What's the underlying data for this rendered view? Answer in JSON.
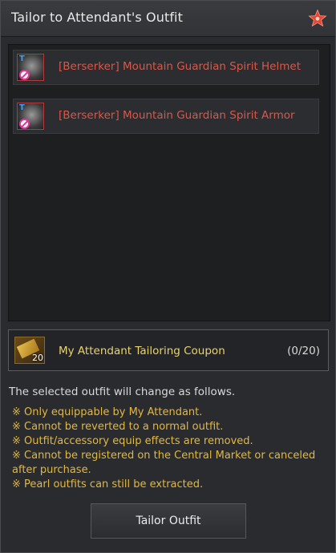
{
  "window": {
    "title": "Tailor to Attendant's Outfit",
    "star_icon": "star-icon",
    "accent_color": "#e0463a"
  },
  "outfits": [
    {
      "name": "[Berserker] Mountain Guardian Spirit Helmet",
      "icon": "helmet-icon",
      "badge": "T"
    },
    {
      "name": "[Berserker] Mountain Guardian Spirit Armor",
      "icon": "armor-icon",
      "badge": "T"
    }
  ],
  "coupon": {
    "name": "My Attendant Tailoring Coupon",
    "quantity": "(0/20)",
    "icon_count": "20",
    "icon": "coupon-icon"
  },
  "info": {
    "intro": "The selected outfit will change as follows.",
    "notes": [
      "※ Only equippable by My Attendant.",
      "※ Cannot be reverted to a normal outfit.",
      "※ Outfit/accessory equip effects are removed.",
      "※ Cannot be registered on the Central Market or canceled after purchase.",
      "※ Pearl outfits can still be extracted."
    ]
  },
  "actions": {
    "tailor_label": "Tailor Outfit"
  },
  "colors": {
    "item_name": "#d9574a",
    "coupon_name": "#e9d36f",
    "note_text": "#e2b83f"
  }
}
